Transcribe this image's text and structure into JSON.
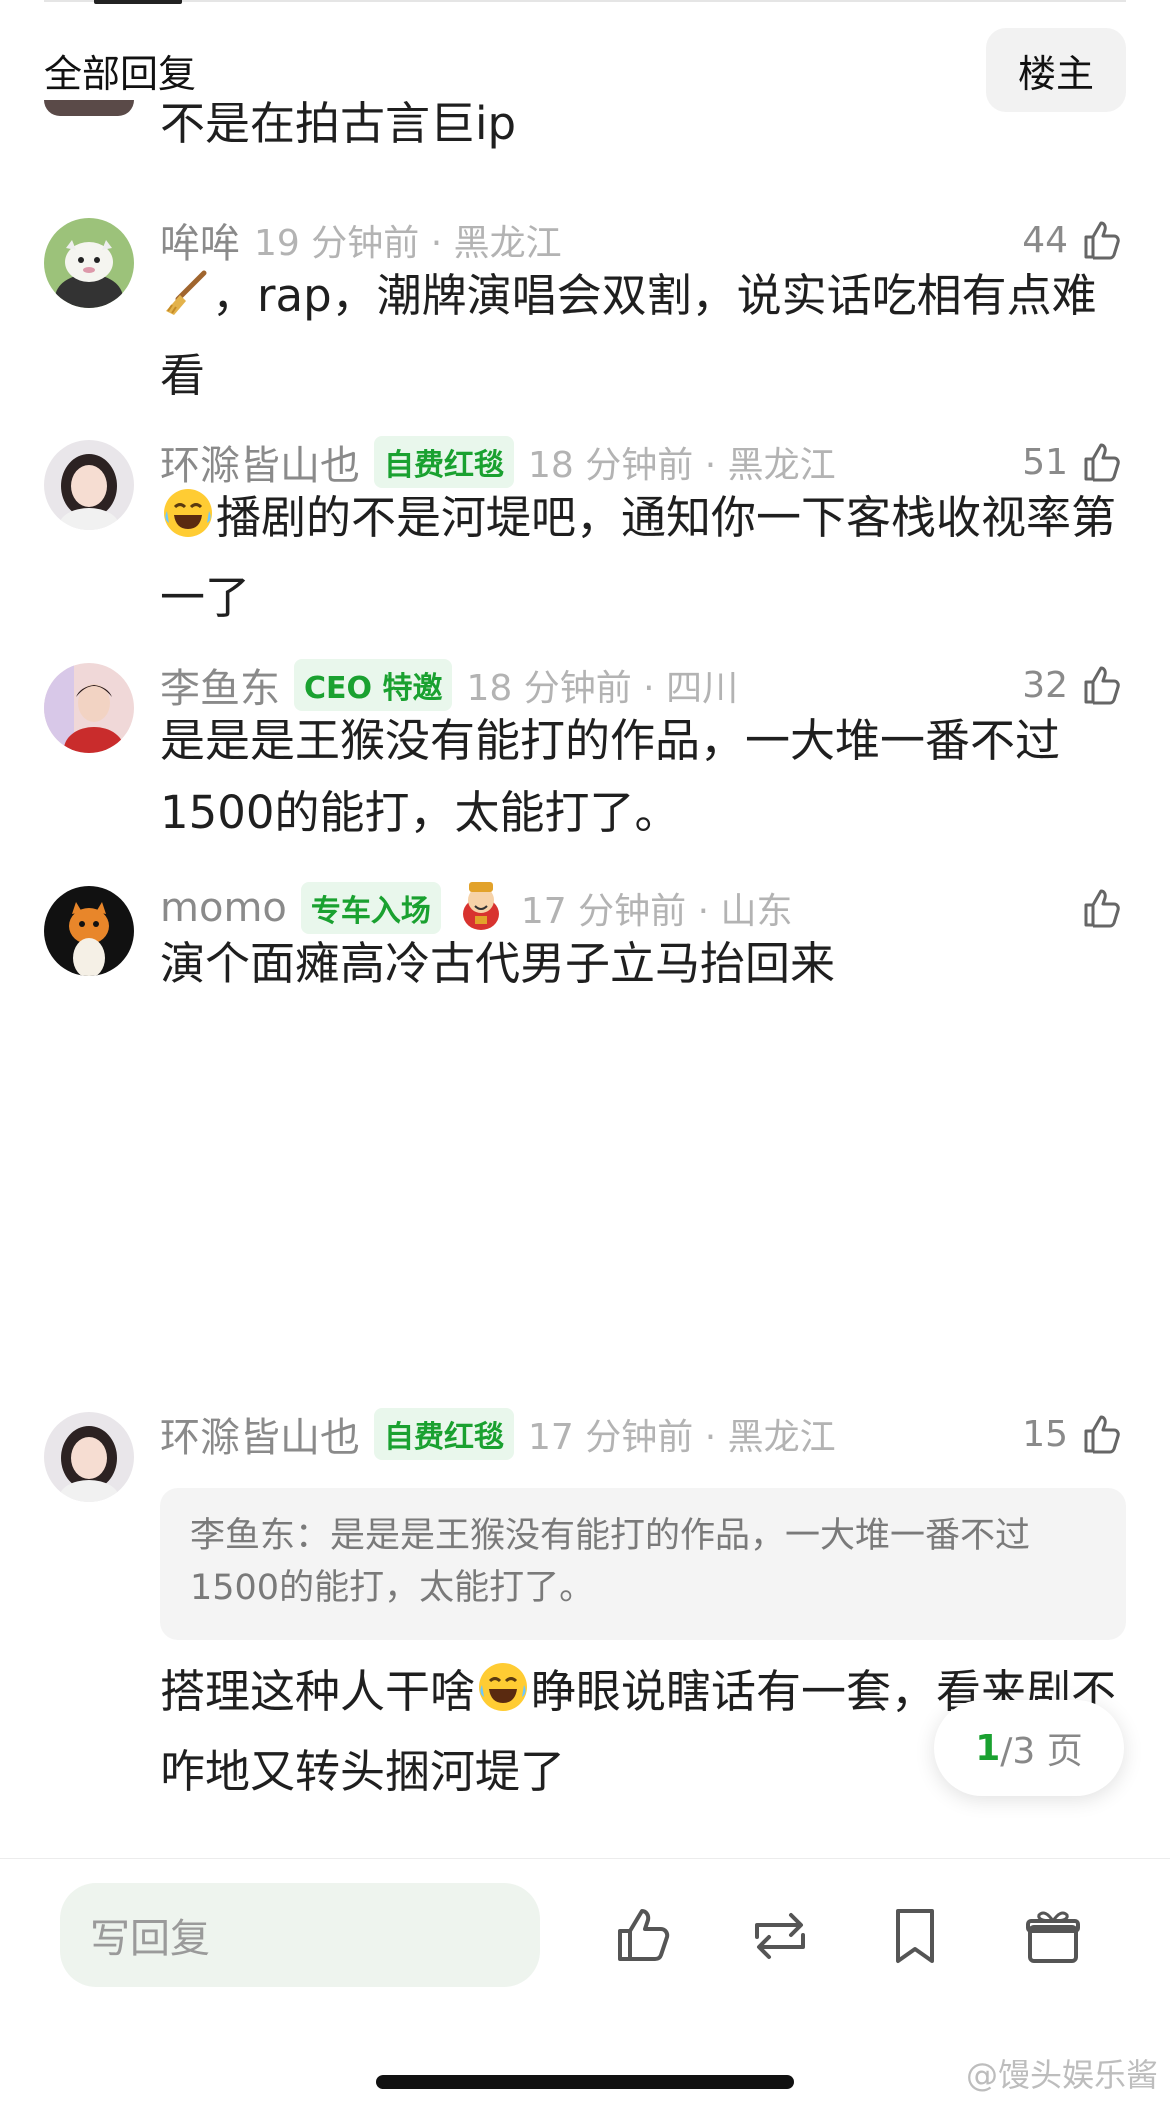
{
  "header": {
    "title": "全部回复",
    "owner_button": "楼主"
  },
  "comments": [
    {
      "text": "不是在拍古言巨ip"
    },
    {
      "username": "哞哞",
      "time": "19 分钟前",
      "location": "黑龙江",
      "likes": "44",
      "text": "，rap，潮牌演唱会双割，说实话吃相有点难看",
      "emoji": "broom"
    },
    {
      "username": "环滁皆山也",
      "badge": "自费红毯",
      "time": "18 分钟前",
      "location": "黑龙江",
      "likes": "51",
      "text": "播剧的不是河堤吧，通知你一下客栈收视率第一了",
      "emoji": "laugh-cry"
    },
    {
      "username": "李鱼东",
      "badge": "CEO 特邀",
      "time": "18 分钟前",
      "location": "四川",
      "likes": "32",
      "text": "是是是王猴没有能打的作品，一大堆一番不过1500的能打，太能打了。"
    },
    {
      "username": "momo",
      "badge": "专车入场",
      "time": "17 分钟前",
      "location": "山东",
      "likes": "",
      "text": "演个面瘫高冷古代男子立马抬回来",
      "emoji": "fortune-god"
    },
    {
      "username": "环滁皆山也",
      "badge": "自费红毯",
      "time": "17 分钟前",
      "location": "黑龙江",
      "likes": "15",
      "quote": "李鱼东：是是是王猴没有能打的作品，一大堆一番不过1500的能打，太能打了。",
      "text_a": "搭理这种人干啥",
      "text_b": "睁眼说瞎话有一套，看来剧不咋地又转头捆河堤了",
      "emoji": "laugh-cry"
    }
  ],
  "pager": {
    "current": "1",
    "total": "/3 页"
  },
  "bottom_bar": {
    "reply_placeholder": "写回复"
  },
  "watermark": "@馒头娱乐酱",
  "colors": {
    "accent_green": "#1aa130",
    "badge_bg": "#e9f7ec",
    "meta_gray": "#b3b3b3"
  }
}
